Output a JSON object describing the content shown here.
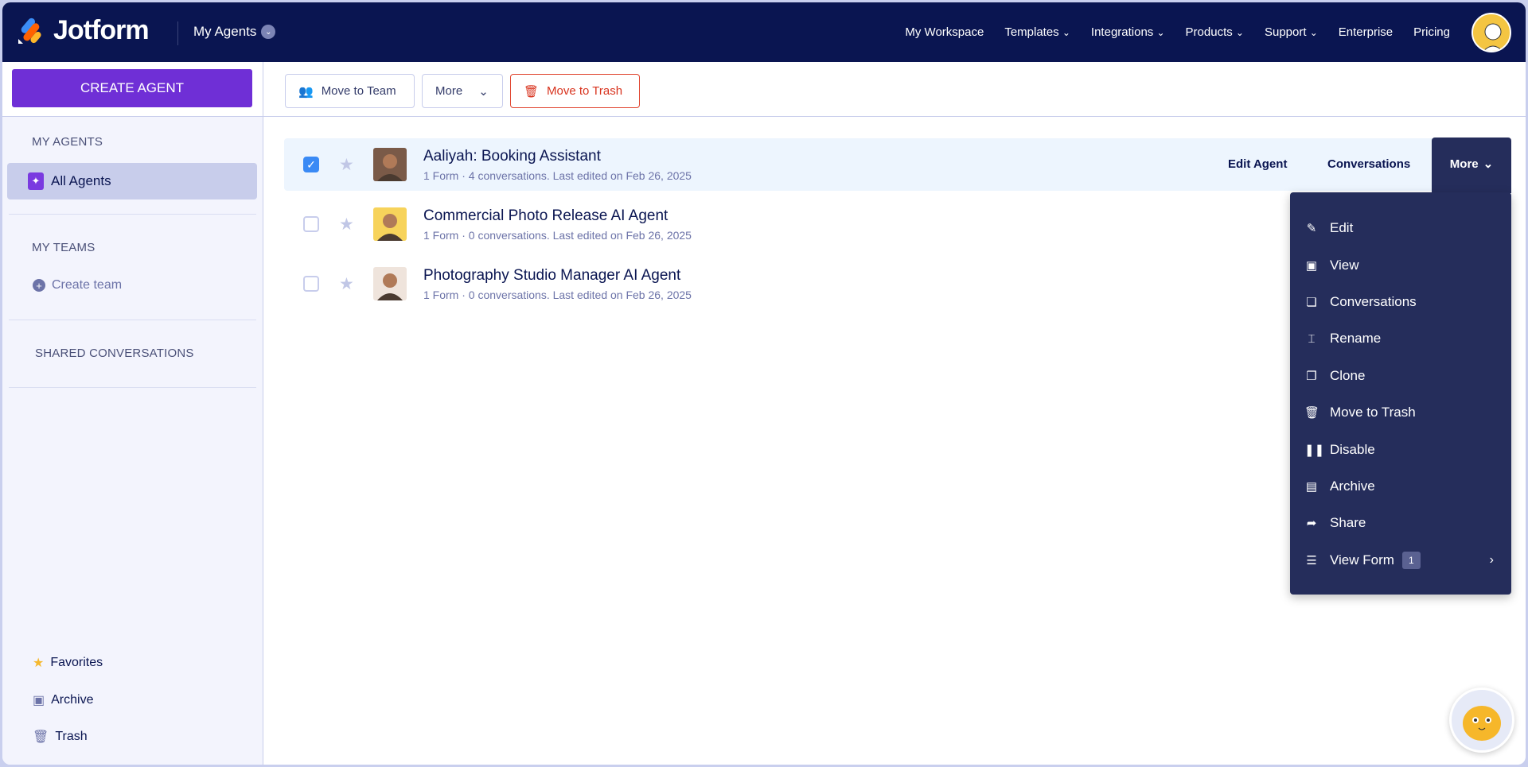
{
  "header": {
    "logo": "Jotform",
    "workspace_switch": "My Agents",
    "nav": [
      "My Workspace",
      "Templates",
      "Integrations",
      "Products",
      "Support",
      "Enterprise",
      "Pricing"
    ],
    "nav_dropdowns": [
      false,
      true,
      true,
      true,
      true,
      false,
      false
    ]
  },
  "sidebar": {
    "create_label": "CREATE AGENT",
    "my_agents": "MY AGENTS",
    "all_agents": "All Agents",
    "my_teams": "MY TEAMS",
    "create_team": "Create team",
    "shared": "SHARED CONVERSATIONS",
    "favorites": "Favorites",
    "archive": "Archive",
    "trash": "Trash"
  },
  "toolbar": {
    "move_team": "Move to Team",
    "more": "More",
    "move_trash": "Move to Trash"
  },
  "agents": [
    {
      "title": "Aaliyah: Booking Assistant",
      "meta": "1 Form · 4 conversations. Last edited on Feb 26, 2025",
      "checked": true
    },
    {
      "title": "Commercial Photo Release AI Agent",
      "meta": "1 Form · 0 conversations. Last edited on Feb 26, 2025",
      "checked": false
    },
    {
      "title": "Photography Studio Manager AI Agent",
      "meta": "1 Form · 0 conversations. Last edited on Feb 26, 2025",
      "checked": false
    }
  ],
  "row_actions": {
    "edit": "Edit Agent",
    "conversations": "Conversations",
    "more": "More"
  },
  "menu": [
    {
      "label": "Edit",
      "icon": "edit-icon"
    },
    {
      "label": "View",
      "icon": "view-icon"
    },
    {
      "label": "Conversations",
      "icon": "conversations-icon"
    },
    {
      "label": "Rename",
      "icon": "rename-icon"
    },
    {
      "label": "Clone",
      "icon": "clone-icon"
    },
    {
      "label": "Move to Trash",
      "icon": "trash-icon"
    },
    {
      "label": "Disable",
      "icon": "pause-icon"
    },
    {
      "label": "Archive",
      "icon": "archive-icon"
    },
    {
      "label": "Share",
      "icon": "share-icon"
    },
    {
      "label": "View Form",
      "icon": "form-icon",
      "badge": "1"
    }
  ],
  "colors": {
    "header": "#0a1551",
    "accent": "#6f2fd6",
    "menu": "#252d5b",
    "danger": "#d8331e"
  }
}
